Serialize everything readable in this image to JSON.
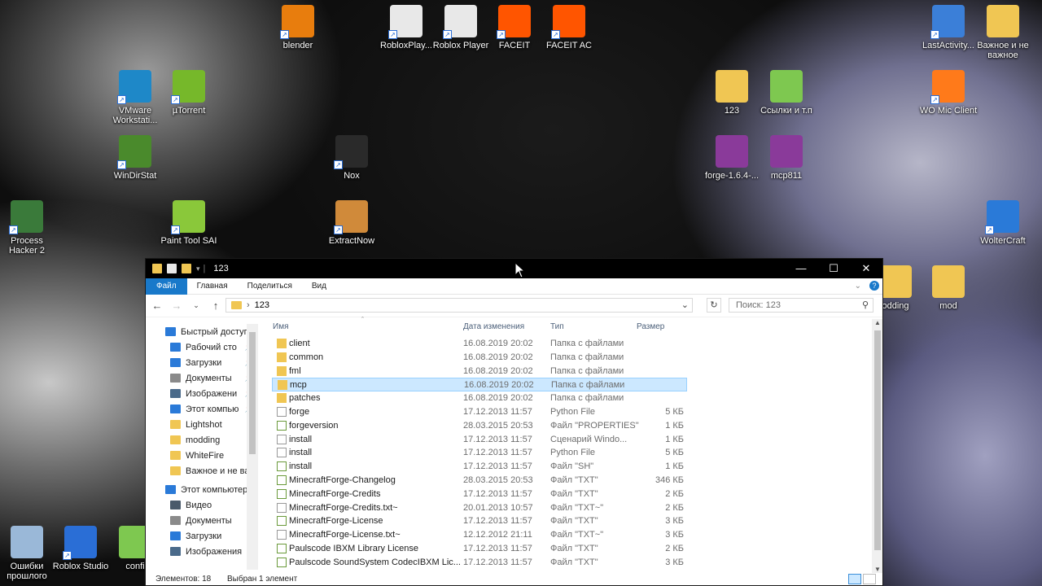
{
  "desktop": {
    "icons": [
      {
        "id": "blender",
        "label": "blender",
        "color": "#e87d0d"
      },
      {
        "id": "roblox-player-1",
        "label": "RobloxPlay...",
        "color": "#e8e8e8"
      },
      {
        "id": "roblox-player-2",
        "label": "Roblox Player",
        "color": "#e8e8e8"
      },
      {
        "id": "faceit",
        "label": "FACEIT",
        "color": "#ff5500"
      },
      {
        "id": "faceit-ac",
        "label": "FACEIT AC",
        "color": "#ff5500"
      },
      {
        "id": "lastactivity",
        "label": "LastActivity...",
        "color": "#3b7fd8"
      },
      {
        "id": "vazhnoe",
        "label": "Важное и не важное",
        "color": "#f0c653"
      },
      {
        "id": "vmware",
        "label": "VMware Workstati...",
        "color": "#1e88c8"
      },
      {
        "id": "utorrent",
        "label": "µTorrent",
        "color": "#76b82a"
      },
      {
        "id": "folder-123",
        "label": "123",
        "color": "#f0c653"
      },
      {
        "id": "ssylki",
        "label": "Ссылки и т.п",
        "color": "#7ec850"
      },
      {
        "id": "wo-mic",
        "label": "WO Mic Client",
        "color": "#ff7a1a"
      },
      {
        "id": "windirstat",
        "label": "WinDirStat",
        "color": "#4a8a2c"
      },
      {
        "id": "nox",
        "label": "Nox",
        "color": "#2a2a2a"
      },
      {
        "id": "forge-rar",
        "label": "forge-1.6.4-...",
        "color": "#8a3a9a"
      },
      {
        "id": "mcp811",
        "label": "mcp811",
        "color": "#8a3a9a"
      },
      {
        "id": "process-hacker",
        "label": "Process Hacker 2",
        "color": "#3a7a3a"
      },
      {
        "id": "painttool",
        "label": "Paint Tool SAI",
        "color": "#8ac83a"
      },
      {
        "id": "extractnow",
        "label": "ExtractNow",
        "color": "#d08a3a"
      },
      {
        "id": "woltercraft",
        "label": "WolterCraft",
        "color": "#2a7ad8"
      },
      {
        "id": "modding",
        "label": "odding",
        "color": "#f0c653"
      },
      {
        "id": "mod",
        "label": "mod",
        "color": "#f0c653"
      },
      {
        "id": "recycle",
        "label": "Ошибки прошлого",
        "color": "#9ab8d8"
      },
      {
        "id": "roblox-studio",
        "label": "Roblox Studio",
        "color": "#2a6ed6"
      },
      {
        "id": "config",
        "label": "confi",
        "color": "#7ec850"
      }
    ]
  },
  "explorer": {
    "title": "123",
    "ribbon_tabs": [
      "Файл",
      "Главная",
      "Поделиться",
      "Вид"
    ],
    "help_label": "?",
    "address": "123",
    "search_placeholder": "Поиск: 123",
    "nav": [
      {
        "label": "Быстрый доступ",
        "icon": "star-icon",
        "color": "#2a7ad8",
        "top": true
      },
      {
        "label": "Рабочий сто",
        "icon": "desktop-icon",
        "color": "#2a7ad8",
        "pin": true
      },
      {
        "label": "Загрузки",
        "icon": "download-icon",
        "color": "#2a7ad8",
        "pin": true
      },
      {
        "label": "Документы",
        "icon": "document-icon",
        "color": "#8a8a8a",
        "pin": true
      },
      {
        "label": "Изображени",
        "icon": "pictures-icon",
        "color": "#4a6a8a",
        "pin": true
      },
      {
        "label": "Этот компью",
        "icon": "computer-icon",
        "color": "#2a7ad8",
        "pin": true
      },
      {
        "label": "Lightshot",
        "icon": "folder-icon",
        "color": "#f0c653"
      },
      {
        "label": "modding",
        "icon": "folder-icon",
        "color": "#f0c653"
      },
      {
        "label": "WhiteFire",
        "icon": "folder-icon",
        "color": "#f0c653"
      },
      {
        "label": "Важное и не ва",
        "icon": "folder-icon",
        "color": "#f0c653"
      },
      {
        "label": "Этот компьютер",
        "icon": "computer-icon",
        "color": "#2a7ad8",
        "top": true
      },
      {
        "label": "Видео",
        "icon": "video-icon",
        "color": "#4a5a6a"
      },
      {
        "label": "Документы",
        "icon": "document-icon",
        "color": "#8a8a8a"
      },
      {
        "label": "Загрузки",
        "icon": "download-icon",
        "color": "#2a7ad8"
      },
      {
        "label": "Изображения",
        "icon": "pictures-icon",
        "color": "#4a6a8a"
      }
    ],
    "columns": [
      "Имя",
      "Дата изменения",
      "Тип",
      "Размер"
    ],
    "files": [
      {
        "name": "client",
        "date": "16.08.2019 20:02",
        "type": "Папка с файлами",
        "size": "",
        "kind": "folder"
      },
      {
        "name": "common",
        "date": "16.08.2019 20:02",
        "type": "Папка с файлами",
        "size": "",
        "kind": "folder"
      },
      {
        "name": "fml",
        "date": "16.08.2019 20:02",
        "type": "Папка с файлами",
        "size": "",
        "kind": "folder"
      },
      {
        "name": "mcp",
        "date": "16.08.2019 20:02",
        "type": "Папка с файлами",
        "size": "",
        "kind": "folder",
        "selected": true
      },
      {
        "name": "patches",
        "date": "16.08.2019 20:02",
        "type": "Папка с файлами",
        "size": "",
        "kind": "folder"
      },
      {
        "name": "forge",
        "date": "17.12.2013 11:57",
        "type": "Python File",
        "size": "5 КБ",
        "kind": "python"
      },
      {
        "name": "forgeversion",
        "date": "28.03.2015 20:53",
        "type": "Файл \"PROPERTIES\"",
        "size": "1 КБ",
        "kind": "text"
      },
      {
        "name": "install",
        "date": "17.12.2013 11:57",
        "type": "Сценарий Windo...",
        "size": "1 КБ",
        "kind": "script"
      },
      {
        "name": "install",
        "date": "17.12.2013 11:57",
        "type": "Python File",
        "size": "5 КБ",
        "kind": "python"
      },
      {
        "name": "install",
        "date": "17.12.2013 11:57",
        "type": "Файл \"SH\"",
        "size": "1 КБ",
        "kind": "text"
      },
      {
        "name": "MinecraftForge-Changelog",
        "date": "28.03.2015 20:53",
        "type": "Файл \"TXT\"",
        "size": "346 КБ",
        "kind": "text"
      },
      {
        "name": "MinecraftForge-Credits",
        "date": "17.12.2013 11:57",
        "type": "Файл \"TXT\"",
        "size": "2 КБ",
        "kind": "text"
      },
      {
        "name": "MinecraftForge-Credits.txt~",
        "date": "20.01.2013 10:57",
        "type": "Файл \"TXT~\"",
        "size": "2 КБ",
        "kind": "blank"
      },
      {
        "name": "MinecraftForge-License",
        "date": "17.12.2013 11:57",
        "type": "Файл \"TXT\"",
        "size": "3 КБ",
        "kind": "text"
      },
      {
        "name": "MinecraftForge-License.txt~",
        "date": "12.12.2012 21:11",
        "type": "Файл \"TXT~\"",
        "size": "3 КБ",
        "kind": "blank"
      },
      {
        "name": "Paulscode IBXM Library License",
        "date": "17.12.2013 11:57",
        "type": "Файл \"TXT\"",
        "size": "2 КБ",
        "kind": "text"
      },
      {
        "name": "Paulscode SoundSystem CodecIBXM Lic...",
        "date": "17.12.2013 11:57",
        "type": "Файл \"TXT\"",
        "size": "3 КБ",
        "kind": "text"
      }
    ],
    "status_items": "Элементов: 18",
    "status_selected": "Выбран 1 элемент",
    "accent_color": "#1979ca",
    "selection_color": "#cce8ff"
  }
}
